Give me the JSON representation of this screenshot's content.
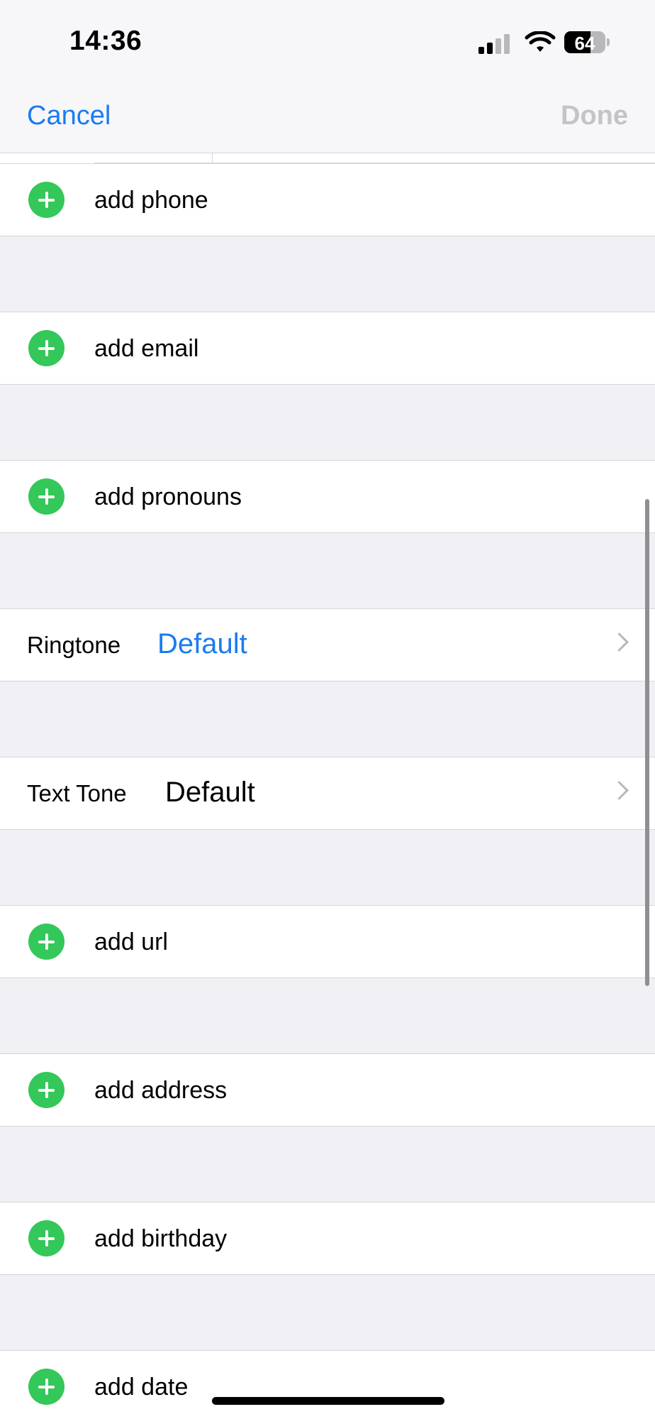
{
  "status_bar": {
    "time": "14:36",
    "battery": "64",
    "battery_level": 0.64
  },
  "nav": {
    "cancel_label": "Cancel",
    "done_label": "Done"
  },
  "rows": {
    "add_phone": "add phone",
    "add_email": "add email",
    "add_pronouns": "add pronouns",
    "ringtone": {
      "label": "Ringtone",
      "value": "Default",
      "value_color": "#1a7cf0"
    },
    "text_tone": {
      "label": "Text Tone",
      "value": "Default",
      "value_color": "#000000"
    },
    "add_url": "add url",
    "add_address": "add address",
    "add_birthday": "add birthday",
    "add_date": "add date"
  },
  "colors": {
    "accent": "#1a7cf0",
    "add_green": "#34c759",
    "disabled": "#c4c4c7"
  }
}
